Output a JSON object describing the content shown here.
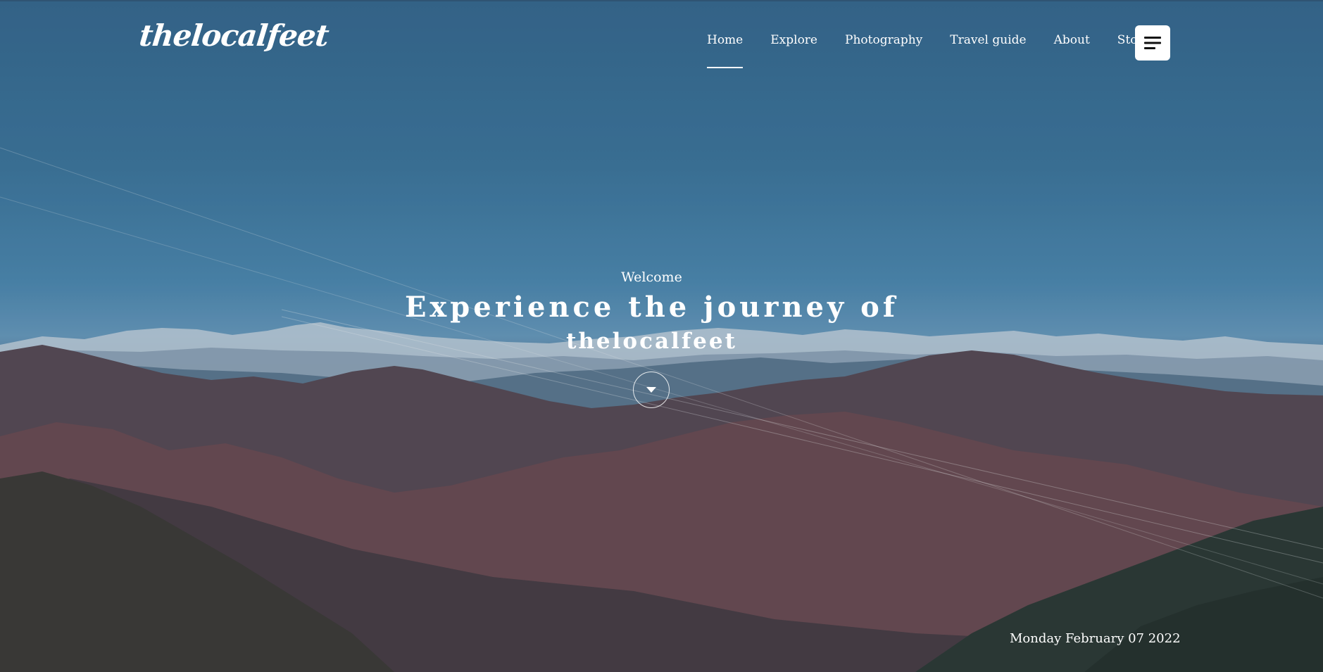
{
  "brand": {
    "logo_text": "thelocalfeet"
  },
  "nav": {
    "items": [
      {
        "label": "Home",
        "active": true
      },
      {
        "label": "Explore",
        "active": false
      },
      {
        "label": "Photography",
        "active": false
      },
      {
        "label": "Travel guide",
        "active": false
      },
      {
        "label": "About",
        "active": false
      },
      {
        "label": "Store",
        "active": false
      }
    ],
    "menu_icon": "hamburger-menu-icon"
  },
  "hero": {
    "welcome": "Welcome",
    "headline_line1": "Experience the journey of",
    "headline_line2": "thelocalfeet",
    "scroll_icon": "caret-down-icon",
    "date": "Monday February 07 2022"
  },
  "colors": {
    "text": "#ffffff",
    "sky_top": "#386a91",
    "sky_low": "#6a9cc0",
    "mountain_far": "#6b7d8e",
    "mountain_mid": "#5a4650",
    "forest": "#2d3a34"
  }
}
